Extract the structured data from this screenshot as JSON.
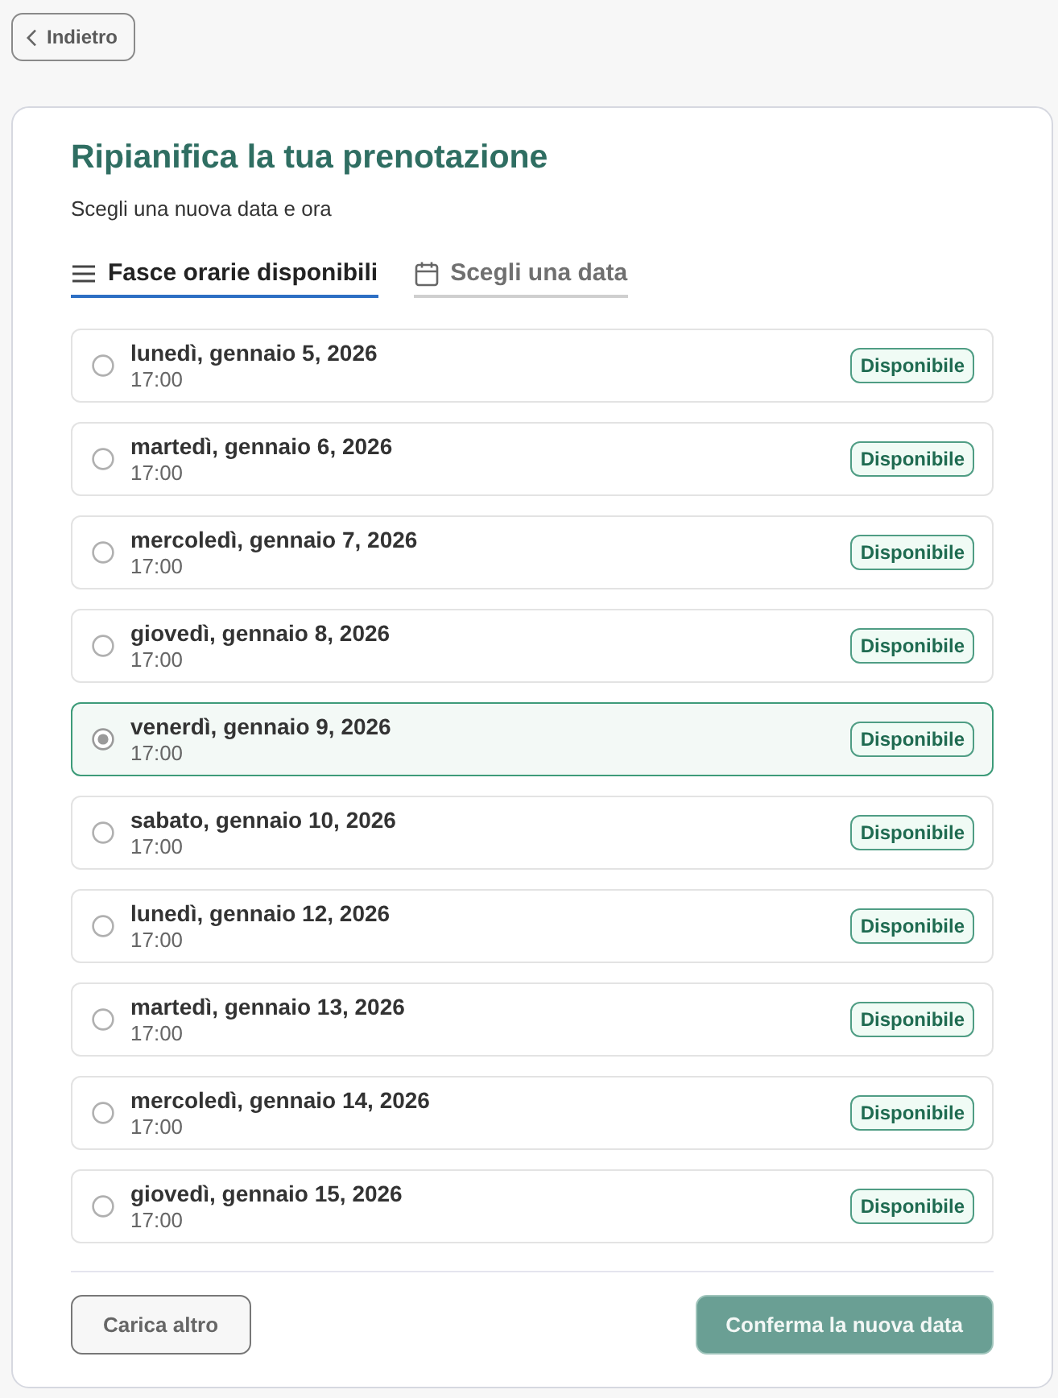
{
  "back_button": {
    "label": "Indietro"
  },
  "card": {
    "title": "Ripianifica la tua prenotazione",
    "subtitle": "Scegli una nuova data e ora"
  },
  "tabs": [
    {
      "label": "Fasce orarie disponibili",
      "kind": "list",
      "selected": true
    },
    {
      "label": "Scegli una data",
      "kind": "calendar",
      "selected": false
    }
  ],
  "slots": [
    {
      "date": "lunedì, gennaio 5, 2026",
      "time": "17:00",
      "badge": "Disponibile",
      "selected": false
    },
    {
      "date": "martedì, gennaio 6, 2026",
      "time": "17:00",
      "badge": "Disponibile",
      "selected": false
    },
    {
      "date": "mercoledì, gennaio 7, 2026",
      "time": "17:00",
      "badge": "Disponibile",
      "selected": false
    },
    {
      "date": "giovedì, gennaio 8, 2026",
      "time": "17:00",
      "badge": "Disponibile",
      "selected": false
    },
    {
      "date": "venerdì, gennaio 9, 2026",
      "time": "17:00",
      "badge": "Disponibile",
      "selected": true
    },
    {
      "date": "sabato, gennaio 10, 2026",
      "time": "17:00",
      "badge": "Disponibile",
      "selected": false
    },
    {
      "date": "lunedì, gennaio 12, 2026",
      "time": "17:00",
      "badge": "Disponibile",
      "selected": false
    },
    {
      "date": "martedì, gennaio 13, 2026",
      "time": "17:00",
      "badge": "Disponibile",
      "selected": false
    },
    {
      "date": "mercoledì, gennaio 14, 2026",
      "time": "17:00",
      "badge": "Disponibile",
      "selected": false
    },
    {
      "date": "giovedì, gennaio 15, 2026",
      "time": "17:00",
      "badge": "Disponibile",
      "selected": false
    }
  ],
  "footer": {
    "load_more": {
      "label": "Carica altro"
    },
    "confirm": {
      "label": "Conferma la nuova data",
      "disabled": true
    }
  }
}
